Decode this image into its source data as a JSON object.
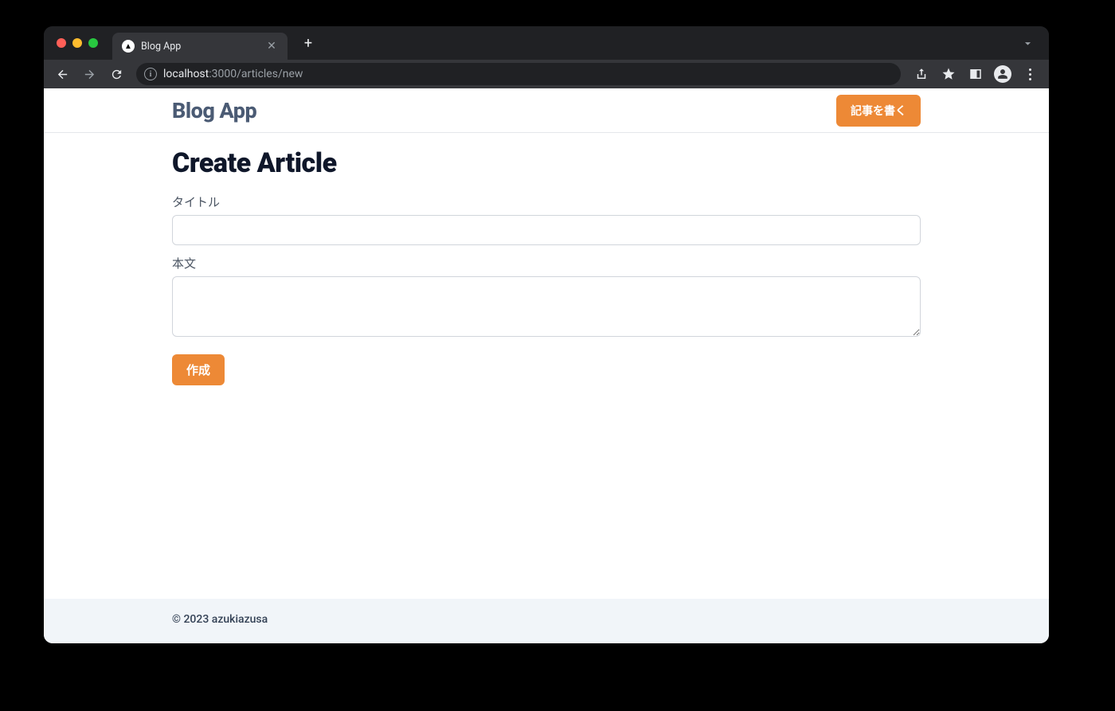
{
  "browser": {
    "tab_title": "Blog App",
    "url_host": "localhost",
    "url_rest": ":3000/articles/new"
  },
  "header": {
    "brand": "Blog App",
    "write_button": "記事を書く"
  },
  "page": {
    "title": "Create Article",
    "labels": {
      "title": "タイトル",
      "body": "本文"
    },
    "values": {
      "title": "",
      "body": ""
    },
    "submit": "作成"
  },
  "footer": {
    "copyright": "© 2023 azukiazusa"
  }
}
